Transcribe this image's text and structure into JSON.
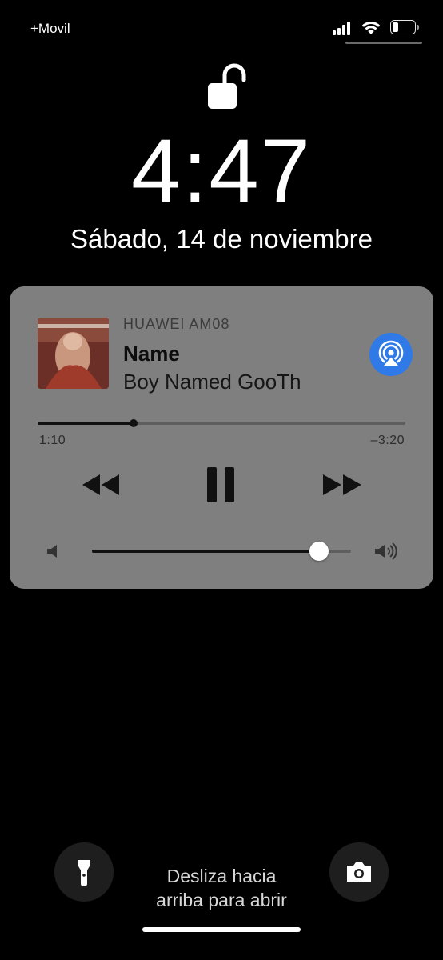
{
  "status_bar": {
    "carrier": "+Movil",
    "signal_bars": 4,
    "battery_level": 0.25
  },
  "lock_screen": {
    "time": "4:47",
    "date": "Sábado, 14 de noviembre",
    "lock_icon": "unlocked-padlock-icon"
  },
  "now_playing": {
    "output_device": "HUAWEI AM08",
    "title": "Name",
    "subtitle": "Boy Named Goo",
    "subtitle_next_fragment": "Th",
    "album_art": "album-art",
    "elapsed": "1:10",
    "remaining": "–3:20",
    "progress": 0.26,
    "volume": 0.875,
    "accent_color": "#2f7ae6",
    "controls": [
      "rewind-icon",
      "pause-icon",
      "fast-forward-icon"
    ]
  },
  "bottom": {
    "swipe_hint_line1": "Desliza hacia",
    "swipe_hint_line2": "arriba para abrir",
    "left_button_icon": "flashlight-icon",
    "right_button_icon": "camera-icon"
  }
}
